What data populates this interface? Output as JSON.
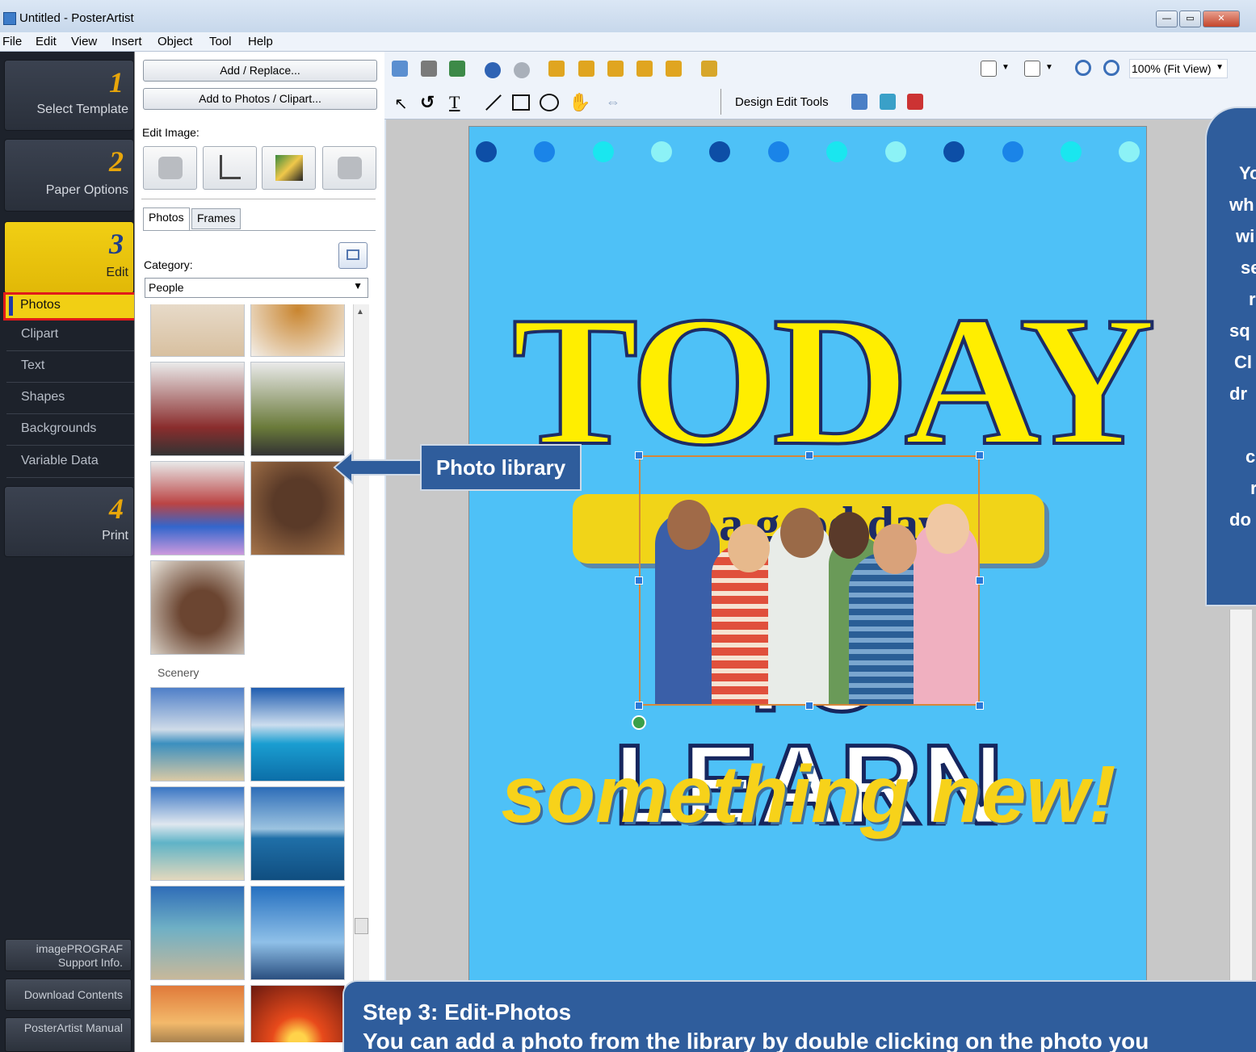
{
  "window": {
    "title": "Untitled - PosterArtist",
    "minimize": "—",
    "maximize": "▭",
    "close": "✕"
  },
  "menu": [
    "File",
    "Edit",
    "View",
    "Insert",
    "Object",
    "Tool",
    "Help"
  ],
  "steps": [
    {
      "num": "1",
      "label": "Select Template"
    },
    {
      "num": "2",
      "label": "Paper Options"
    },
    {
      "num": "3",
      "label": "Edit"
    },
    {
      "num": "4",
      "label": "Print"
    }
  ],
  "edit_subitems": [
    "Photos",
    "Clipart",
    "Text",
    "Shapes",
    "Backgrounds",
    "Variable Data"
  ],
  "bottom_buttons": [
    "imagePROGRAF Support Info.",
    "Download Contents",
    "PosterArtist Manual"
  ],
  "panel": {
    "add_replace": "Add / Replace...",
    "add_to_photos": "Add to Photos / Clipart...",
    "edit_image_label": "Edit Image:",
    "tabs": [
      "Photos",
      "Frames"
    ],
    "category_label": "Category:",
    "category_value": "People",
    "section_scenery": "Scenery"
  },
  "toolbar": {
    "zoom_value": "100% (Fit View)",
    "design_edit_tools": "Design Edit Tools"
  },
  "poster": {
    "line1": "TODAY",
    "line2": "is a good day",
    "line3": "TO LEARN",
    "line4": "something new!"
  },
  "callouts": {
    "photo_library": "Photo library",
    "side_lines": [
      "Yo",
      "wh",
      "wi",
      "se",
      "r",
      "sq",
      "Cl",
      "dr",
      "",
      "c",
      "r",
      "do"
    ],
    "bottom_title": "Step 3: Edit-Photos",
    "bottom_body": "You can add a photo from the library by double clicking on the photo you"
  },
  "colors": {
    "accent_yellow": "#f1cf14",
    "poster_blue": "#4ec1f7",
    "callout_blue": "#2f5d9c"
  }
}
